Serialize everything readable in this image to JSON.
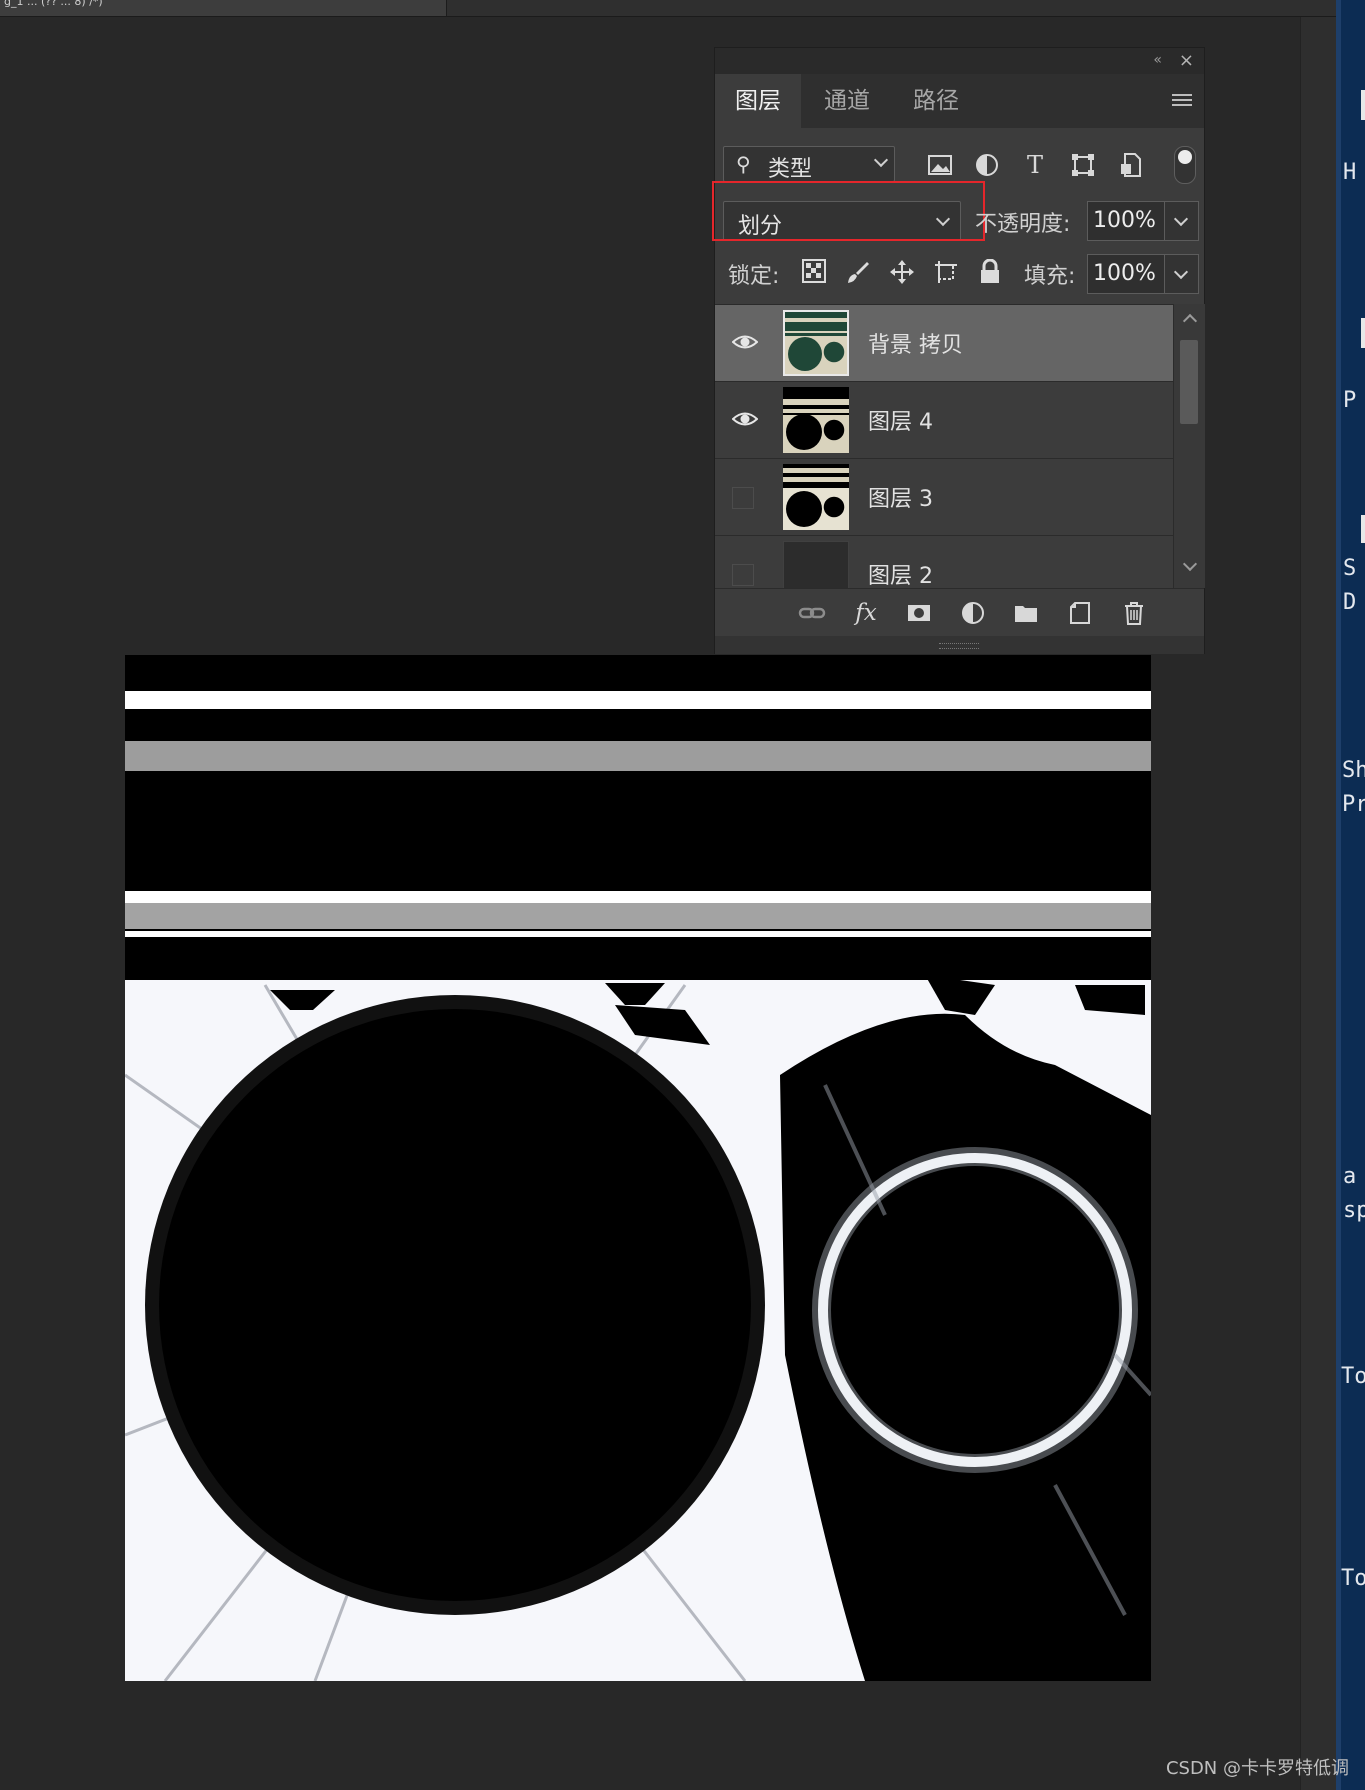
{
  "document_tab": {
    "title": "g_1 ... (?? ... 8) /*)"
  },
  "layers_panel": {
    "tabs": [
      {
        "label": "图层"
      },
      {
        "label": "通道"
      },
      {
        "label": "路径"
      }
    ],
    "filter": {
      "label": "类型"
    },
    "blend_mode": {
      "value": "划分"
    },
    "opacity": {
      "label": "不透明度:",
      "value": "100%"
    },
    "lock": {
      "label": "锁定:"
    },
    "fill": {
      "label": "填充:",
      "value": "100%"
    },
    "layers": [
      {
        "name": "背景 拷贝",
        "visible": true,
        "selected": true
      },
      {
        "name": "图层 4",
        "visible": true,
        "selected": false
      },
      {
        "name": "图层 3",
        "visible": false,
        "selected": false
      },
      {
        "name": "图层 2",
        "visible": false,
        "selected": false
      }
    ]
  },
  "side_text": [
    "H",
    "P",
    "S",
    "D",
    "Sh",
    "Pr",
    "a",
    "sp",
    "To",
    "To"
  ],
  "watermark": "CSDN @卡卡罗特低调"
}
